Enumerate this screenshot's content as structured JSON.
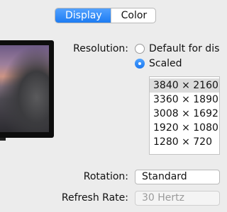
{
  "tabs": [
    {
      "label": "Display",
      "active": true
    },
    {
      "label": "Color",
      "active": false
    }
  ],
  "resolution": {
    "label": "Resolution:",
    "options": [
      {
        "label": "Default for dis",
        "checked": false
      },
      {
        "label": "Scaled",
        "checked": true
      }
    ],
    "scaled_list": [
      "3840 × 2160",
      "3360 × 1890",
      "3008 × 1692",
      "1920 × 1080",
      "1280 × 720"
    ],
    "selected_index": 0
  },
  "rotation": {
    "label": "Rotation:",
    "value": "Standard"
  },
  "refresh_rate": {
    "label": "Refresh Rate:",
    "value": "30 Hertz",
    "enabled": false
  },
  "colors": {
    "accent": "#1d7cf2",
    "window_bg": "#ececec",
    "selection_bg": "#dcdcdc"
  }
}
